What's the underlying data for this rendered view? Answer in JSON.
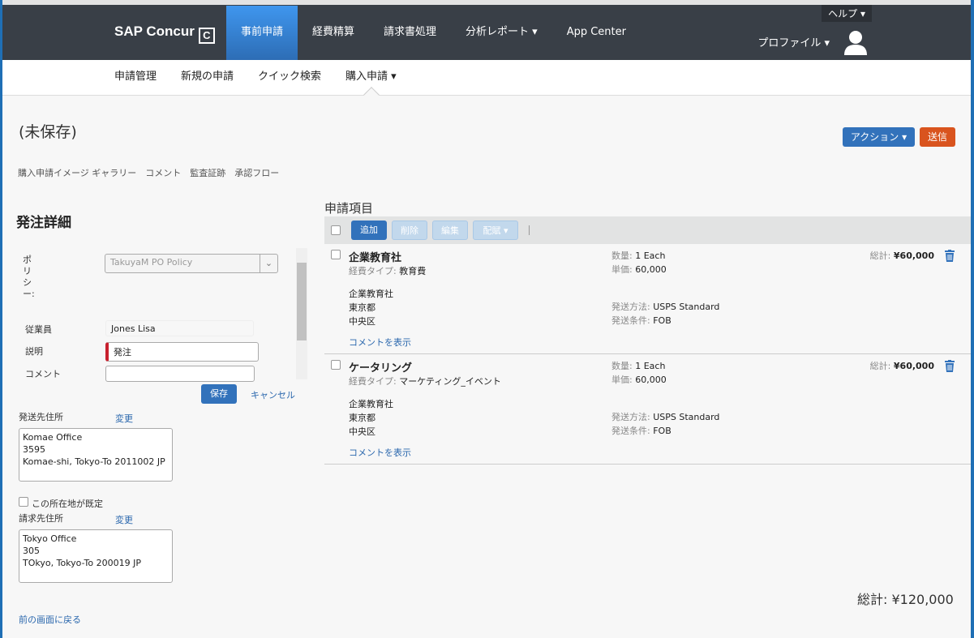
{
  "header": {
    "logo": "SAP Concur",
    "nav": [
      "事前申請",
      "経費精算",
      "請求書処理",
      "分析レポート ▾",
      "App Center"
    ],
    "help": "ヘルプ",
    "profile": "プロファイル"
  },
  "subnav": [
    "申請管理",
    "新規の申請",
    "クイック検索",
    "購入申請 ▾"
  ],
  "page": {
    "title": "(未保存)",
    "action": "アクション ▾",
    "send": "送信",
    "links": [
      "購入申請イメージ ギャラリー",
      "コメント",
      "監査証跡",
      "承認フロー"
    ]
  },
  "form": {
    "heading": "発注詳細",
    "policy_label": "ポ\nリ\nシ\nー:",
    "policy_value": "TakuyaM PO Policy",
    "employee_label": "従業員",
    "employee_value": "Jones Lisa",
    "desc_label": "説明",
    "desc_value": "発注",
    "comment_label": "コメント",
    "comment_value": "",
    "save": "保存",
    "cancel": "キャンセル",
    "ship_label": "発送先住所",
    "change": "変更",
    "ship_lines": [
      "Komae Office",
      "3595",
      "Komae-shi, Tokyo-To 2011002 JP"
    ],
    "default_label": "この所在地が既定",
    "bill_label": "請求先住所",
    "bill_lines": [
      "Tokyo Office",
      "305",
      "TOkyo, Tokyo-To 200019 JP"
    ],
    "back": "前の画面に戻る"
  },
  "items": {
    "heading": "申請項目",
    "toolbar": [
      "追加",
      "削除",
      "編集",
      "配賦 ▾"
    ],
    "rows": [
      {
        "name": "企業教育社",
        "type_label": "経費タイプ:",
        "type": "教育費",
        "qty_label": "数量:",
        "qty": "1 Each",
        "price_label": "単価:",
        "price": "60,000",
        "total_label": "総計:",
        "total": "¥60,000",
        "addr": [
          "企業教育社",
          "東京都",
          "中央区"
        ],
        "ship_label": "発送方法:",
        "ship": "USPS Standard",
        "terms_label": "発送条件:",
        "terms": "FOB",
        "comments": "コメントを表示"
      },
      {
        "name": "ケータリング",
        "type_label": "経費タイプ:",
        "type": "マーケティング_イベント",
        "qty_label": "数量:",
        "qty": "1 Each",
        "price_label": "単価:",
        "price": "60,000",
        "total_label": "総計:",
        "total": "¥60,000",
        "addr": [
          "企業教育社",
          "東京都",
          "中央区"
        ],
        "ship_label": "発送方法:",
        "ship": "USPS Standard",
        "terms_label": "発送条件:",
        "terms": "FOB",
        "comments": "コメントを表示"
      }
    ],
    "grand_total": "総計: ¥120,000"
  }
}
